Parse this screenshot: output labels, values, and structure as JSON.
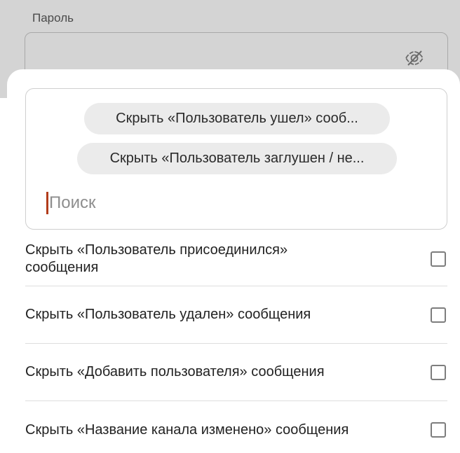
{
  "background_form": {
    "password_label": "Пароль",
    "password_value": "",
    "visibility_icon": "eye-slash-icon"
  },
  "sheet": {
    "selected_chips": [
      {
        "label": "Скрыть «Пользователь ушел» сооб..."
      },
      {
        "label": "Скрыть «Пользователь заглушен / не..."
      }
    ],
    "search": {
      "placeholder": "Поиск",
      "value": ""
    },
    "options": [
      {
        "label": "Скрыть «Пользователь присоединился» сообщения",
        "checked": false
      },
      {
        "label": "Скрыть «Пользователь удален» сообщения",
        "checked": false
      },
      {
        "label": "Скрыть «Добавить пользователя» сообщения",
        "checked": false
      },
      {
        "label": "Скрыть «Название канала изменено» сообщения",
        "checked": false
      }
    ]
  },
  "colors": {
    "backdrop": "#d4d4d4",
    "chip_bg": "#ebebeb",
    "caret": "#b23c1b",
    "divider": "#dedede"
  }
}
